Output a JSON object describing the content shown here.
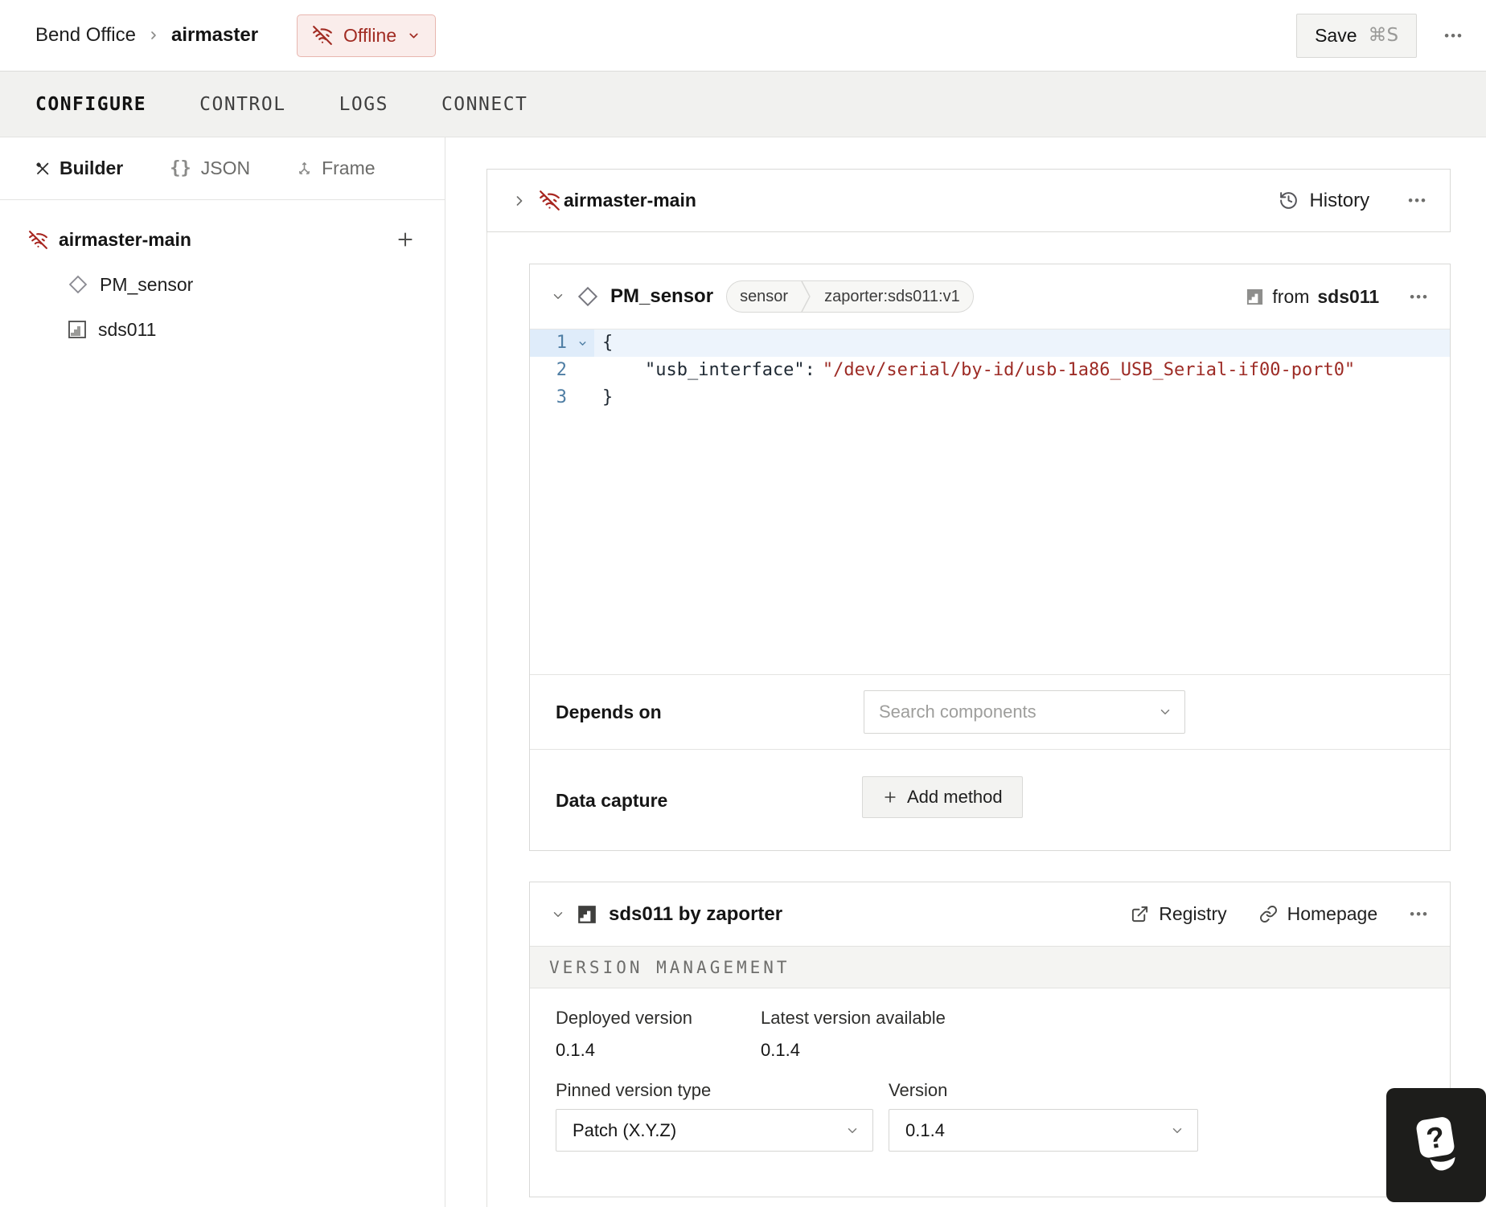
{
  "header": {
    "org": "Bend Office",
    "machine": "airmaster",
    "status_label": "Offline",
    "save_label": "Save",
    "save_shortcut": "⌘S",
    "menu": "•••"
  },
  "tabs": [
    {
      "label": "CONFIGURE",
      "active": true
    },
    {
      "label": "CONTROL",
      "active": false
    },
    {
      "label": "LOGS",
      "active": false
    },
    {
      "label": "CONNECT",
      "active": false
    }
  ],
  "sidebar": {
    "views": [
      {
        "label": "Builder"
      },
      {
        "label": "JSON",
        "icon_glyph": "{}"
      },
      {
        "label": "Frame"
      }
    ],
    "tree": {
      "part": "airmaster-main",
      "children": [
        {
          "label": "PM_sensor"
        },
        {
          "label": "sds011"
        }
      ]
    }
  },
  "part_card": {
    "title": "airmaster-main",
    "history_label": "History",
    "menu": "•••"
  },
  "component_card": {
    "title": "PM_sensor",
    "type_badge": "sensor",
    "model_badge": "zaporter:sds011:v1",
    "from_prefix": "from",
    "from_module": "sds011",
    "menu": "•••",
    "code_lines": [
      {
        "num": "1",
        "text": "{"
      },
      {
        "num": "2",
        "key": "\"usb_interface\":",
        "value": "\"/dev/serial/by-id/usb-1a86_USB_Serial-if00-port0\""
      },
      {
        "num": "3",
        "text": "}"
      }
    ],
    "depends_on_label": "Depends on",
    "depends_on_placeholder": "Search components",
    "data_capture_label": "Data capture",
    "add_method_label": "Add method"
  },
  "module_card": {
    "title": "sds011 by zaporter",
    "registry_label": "Registry",
    "homepage_label": "Homepage",
    "menu": "•••",
    "section_title": "VERSION MANAGEMENT",
    "deployed_label": "Deployed version",
    "deployed_value": "0.1.4",
    "latest_label": "Latest version available",
    "latest_value": "0.1.4",
    "pinned_label": "Pinned version type",
    "pinned_value": "Patch (X.Y.Z)",
    "version_label": "Version",
    "version_value": "0.1.4"
  },
  "icons": {
    "help_glyph": "?"
  },
  "colors": {
    "offline_red": "#a12c23",
    "code_value_red": "#9d2b25",
    "gutter_blue": "#4f7ea4",
    "card_border": "#d9d9d7"
  }
}
